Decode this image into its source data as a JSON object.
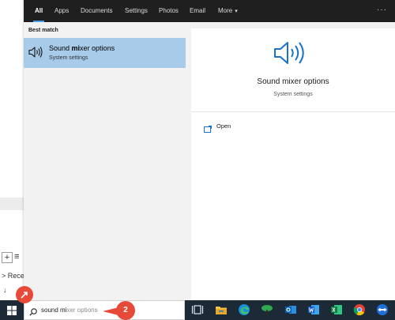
{
  "filter_tabs": [
    {
      "label": "All",
      "active": true
    },
    {
      "label": "Apps"
    },
    {
      "label": "Documents"
    },
    {
      "label": "Settings"
    },
    {
      "label": "Photos"
    },
    {
      "label": "Email"
    },
    {
      "label": "More"
    }
  ],
  "more_caret": "▾",
  "ellipsis": "···",
  "results": {
    "best_match_label": "Best match",
    "item": {
      "title_prefix": "Sound ",
      "title_bold": "mi",
      "title_suffix": "xer options",
      "subtitle": "System settings",
      "icon": "speaker-icon"
    }
  },
  "detail": {
    "title": "Sound mixer options",
    "subtitle": "System settings",
    "open_label": "Open",
    "icon": "speaker-icon"
  },
  "search": {
    "typed": "sound mi",
    "suggestion": "xer options"
  },
  "background_app": {
    "plus": "+",
    "list": "≡",
    "recent": "> Rece",
    "down": "↓"
  },
  "annotations": {
    "badge_1": "",
    "badge_2": "2"
  },
  "colors": {
    "accent": "#4aa0e6",
    "selected_row": "#a8cbea",
    "taskbar": "#1c2a38",
    "badge": "#e84a3a"
  }
}
